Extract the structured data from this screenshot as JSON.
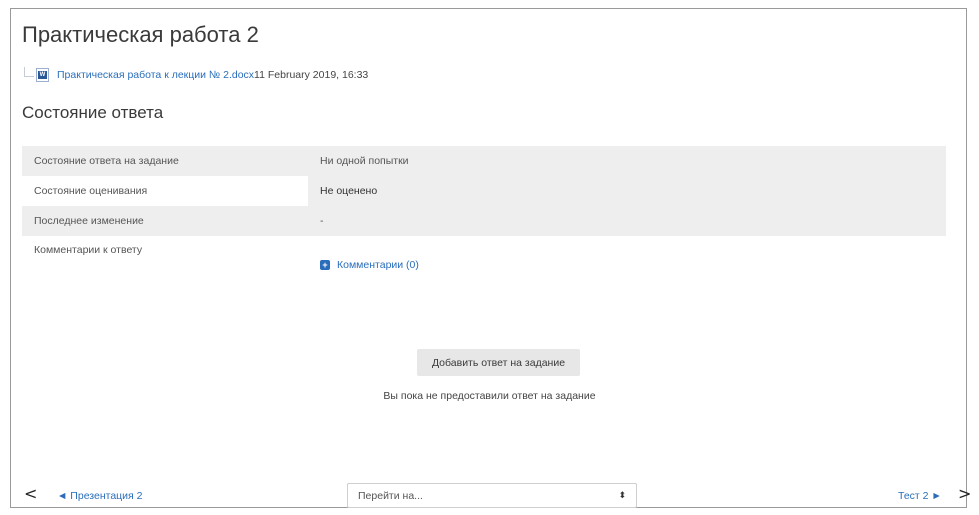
{
  "page_title": "Практическая работа 2",
  "file": {
    "icon": "word-doc-icon",
    "name": "Практическая работа к лекции № 2.docx",
    "date": "11 February 2019, 16:33"
  },
  "section_title": "Состояние ответа",
  "status_rows": [
    {
      "label": "Состояние ответа на задание",
      "value": "Ни одной попытки"
    },
    {
      "label": "Состояние оценивания",
      "value": "Не оценено"
    },
    {
      "label": "Последнее изменение",
      "value": "-"
    },
    {
      "label": "Комментарии к ответу",
      "value": "Комментарии (0)"
    }
  ],
  "add_button_label": "Добавить ответ на задание",
  "no_answer_text": "Вы пока не предоставили ответ на задание",
  "nav": {
    "prev_arrow": "<",
    "prev_label": "◄ Презентация 2",
    "jump_placeholder": "Перейти на...",
    "jump_arrow": "⬍",
    "next_label": "Тест 2 ►",
    "next_arrow": ">"
  },
  "colors": {
    "link": "#2a6ebb",
    "row_bg": "#eeeeee",
    "button_bg": "#e7e7e7"
  }
}
